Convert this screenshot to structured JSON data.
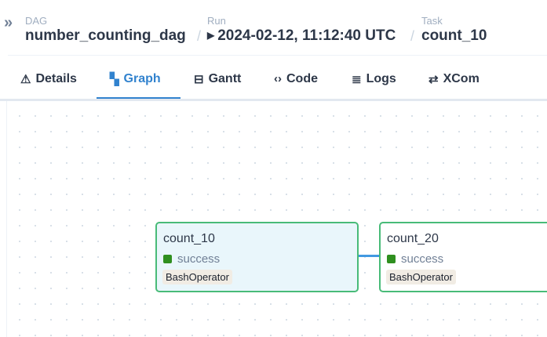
{
  "breadcrumb": {
    "dag_label": "DAG",
    "dag_value": "number_counting_dag",
    "run_label": "Run",
    "run_value": "2024-02-12, 11:12:40 UTC",
    "task_label": "Task",
    "task_value": "count_10",
    "separator": "/",
    "collapse_glyph": "»"
  },
  "tabs": [
    {
      "label": "Details",
      "icon": "⚠"
    },
    {
      "label": "Graph",
      "icon": "▚"
    },
    {
      "label": "Gantt",
      "icon": "⊟"
    },
    {
      "label": "Code",
      "icon": "‹›"
    },
    {
      "label": "Logs",
      "icon": "≣"
    },
    {
      "label": "XCom",
      "icon": "⇄"
    }
  ],
  "active_tab": "Graph",
  "graph": {
    "nodes": [
      {
        "name": "count_10",
        "state": "success",
        "operator": "BashOperator",
        "selected": true
      },
      {
        "name": "count_20",
        "state": "success",
        "operator": "BashOperator",
        "selected": false
      }
    ]
  },
  "colors": {
    "accent": "#3182ce",
    "success_border": "#48bb78",
    "success_dot": "#2f8f1f",
    "edge": "#4299e1"
  }
}
